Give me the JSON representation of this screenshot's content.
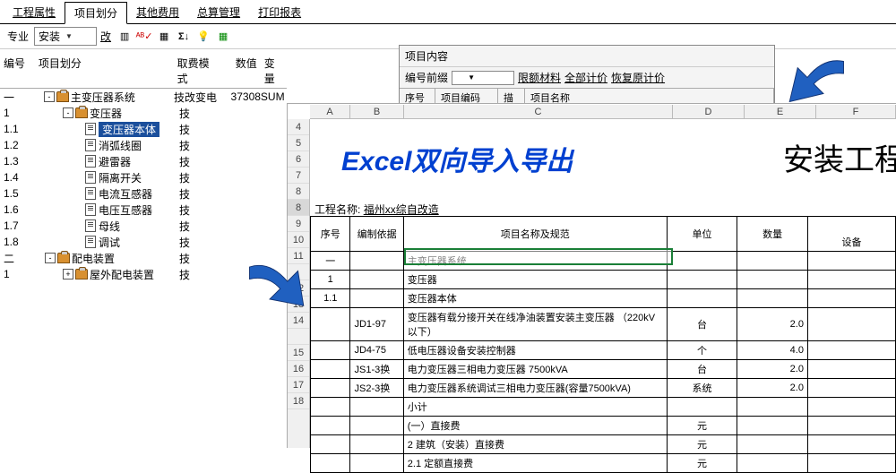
{
  "tabs": [
    "工程属性",
    "项目划分",
    "其他费用",
    "总算管理",
    "打印报表"
  ],
  "active_tab": 1,
  "toolbar": {
    "major_label": "专业",
    "major_value": "安装",
    "edit_label": "改"
  },
  "tree": {
    "headers": {
      "id": "编号",
      "proj": "项目划分",
      "mode": "取费模式",
      "val": "数值",
      "var": "变量"
    },
    "top_val": "37308",
    "top_var": "SUM",
    "row0": {
      "id": "一",
      "label": "主变压器系统",
      "mode": "技改变电"
    },
    "row1": {
      "id": "1",
      "label": "变压器",
      "mode": "技"
    },
    "row2": {
      "id": "1.1",
      "label": "变压器本体",
      "mode": "技"
    },
    "row3": {
      "id": "1.2",
      "label": "消弧线圈",
      "mode": "技"
    },
    "row4": {
      "id": "1.3",
      "label": "避雷器",
      "mode": "技"
    },
    "row5": {
      "id": "1.4",
      "label": "隔离开关",
      "mode": "技"
    },
    "row6": {
      "id": "1.5",
      "label": "电流互感器",
      "mode": "技"
    },
    "row7": {
      "id": "1.6",
      "label": "电压互感器",
      "mode": "技"
    },
    "row8": {
      "id": "1.7",
      "label": "母线",
      "mode": "技"
    },
    "row9": {
      "id": "1.8",
      "label": "调试",
      "mode": "技"
    },
    "row10": {
      "id": "二",
      "label": "配电装置",
      "mode": "技"
    },
    "row11": {
      "id": "1",
      "label": "屋外配电装置",
      "mode": "技"
    }
  },
  "right_panel": {
    "title": "项目内容",
    "prefix_label": "编号前缀",
    "link1": "限额材料",
    "link2": "全部计价",
    "link3": "恢复原计价",
    "cols": {
      "a": "序号",
      "b": "项目编码",
      "c": "描",
      "d": "项目名称"
    }
  },
  "excel": {
    "col_letters": [
      "A",
      "B",
      "C",
      "D",
      "E",
      "F"
    ],
    "blue_title": "Excel双向导入导出",
    "black_title": "安装工程",
    "proj_label": "工程名称:",
    "proj_value": "福州xx综自改造",
    "headers": {
      "seq": "序号",
      "basis": "编制依据",
      "spec": "项目名称及规范",
      "unit": "单位",
      "qty": "数量",
      "equip": "设备"
    },
    "rows": [
      {
        "n": "8",
        "seq": "一",
        "basis": "",
        "spec": "主变压器系统",
        "unit": "",
        "qty": ""
      },
      {
        "n": "9",
        "seq": "1",
        "basis": "",
        "spec": "变压器",
        "unit": "",
        "qty": ""
      },
      {
        "n": "10",
        "seq": "1.1",
        "basis": "",
        "spec": "变压器本体",
        "unit": "",
        "qty": ""
      },
      {
        "n": "11",
        "seq": "",
        "basis": "JD1-97",
        "spec": "变压器有载分接开关在线净油装置安装主变压器 （220kV以下）",
        "unit": "台",
        "qty": "2.0"
      },
      {
        "n": "12",
        "seq": "",
        "basis": "JD4-75",
        "spec": "低电压器设备安装控制器",
        "unit": "个",
        "qty": "4.0"
      },
      {
        "n": "13",
        "seq": "",
        "basis": "JS1-3换",
        "spec": "电力变压器三相电力变压器 7500kVA",
        "unit": "台",
        "qty": "2.0"
      },
      {
        "n": "14",
        "seq": "",
        "basis": "JS2-3换",
        "spec": "电力变压器系统调试三相电力变压器(容量7500kVA)",
        "unit": "系统",
        "qty": "2.0"
      },
      {
        "n": "15",
        "seq": "",
        "basis": "",
        "spec": "小计",
        "unit": "",
        "qty": ""
      },
      {
        "n": "16",
        "seq": "",
        "basis": "",
        "spec": "(一）直接费",
        "unit": "元",
        "qty": ""
      },
      {
        "n": "17",
        "seq": "",
        "basis": "",
        "spec": "2 建筑（安装）直接费",
        "unit": "元",
        "qty": ""
      },
      {
        "n": "18",
        "seq": "",
        "basis": "",
        "spec": "2.1 定额直接费",
        "unit": "元",
        "qty": ""
      }
    ]
  }
}
